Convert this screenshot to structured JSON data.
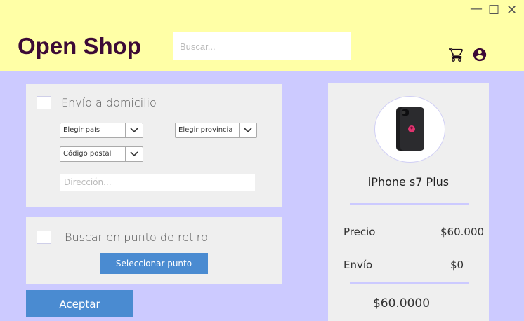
{
  "window": {
    "minimize_symbol": "—",
    "maximize_symbol": "☐",
    "close_symbol": "✕"
  },
  "header": {
    "brand": "Open Shop",
    "search_placeholder": "Buscar...",
    "icons": [
      "cart-icon",
      "account-icon"
    ]
  },
  "delivery": {
    "label": "Envío a domicilio",
    "checked": false,
    "country_select": "Elegir país",
    "province_select": "Elegir provincia",
    "postal_select": "Código postal",
    "address_placeholder": "Dirección..."
  },
  "pickup": {
    "label": "Buscar en punto de retiro",
    "checked": false,
    "select_point_button": "Seleccionar punto"
  },
  "accept_button": "Aceptar",
  "summary": {
    "product_name": "iPhone s7 Plus",
    "price_label": "Precio",
    "price_value": "$60.000",
    "shipping_label": "Envío",
    "shipping_value": "$0",
    "total": "$60.0000"
  },
  "colors": {
    "header_bg": "#ffffa6",
    "page_bg": "#cccaff",
    "brand": "#3c0a36",
    "button": "#4a8bd1",
    "panel": "#efefef"
  }
}
